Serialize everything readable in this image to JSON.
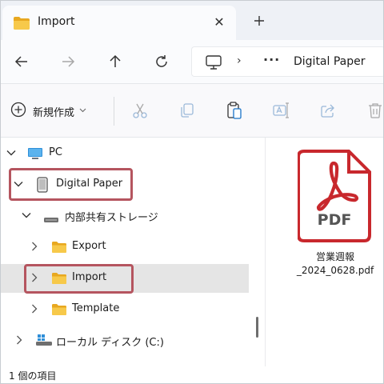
{
  "window": {
    "tab_title": "Import",
    "tab_close": "✕",
    "new_tab": "+"
  },
  "address_bar": {
    "separator": "›",
    "overflow": "···",
    "current": "Digital Paper"
  },
  "command_bar": {
    "new_label": "新規作成",
    "new_dropdown": "⌄"
  },
  "tree": {
    "pc": "PC",
    "device": "Digital Paper",
    "storage": "内部共有ストレージ",
    "export": "Export",
    "import": "Import",
    "template": "Template",
    "local_disk": "ローカル ディスク (C:)"
  },
  "file": {
    "badge": "PDF",
    "name_line1": "営業週報",
    "name_line2": "_2024_0628.pdf"
  },
  "status": {
    "count": "1 個の項目"
  },
  "colors": {
    "highlight": "#b5555f",
    "pdf_red": "#c8282d",
    "folder_yellow": "#f5c242"
  }
}
